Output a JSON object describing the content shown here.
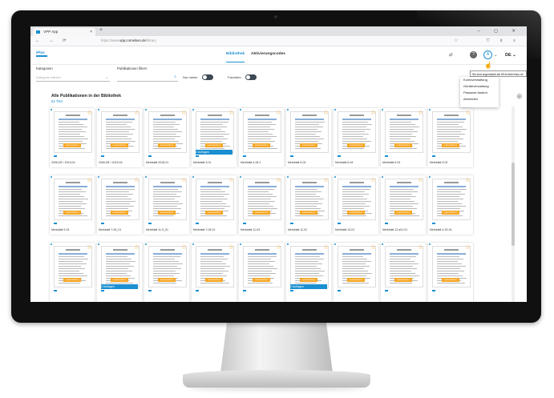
{
  "browser": {
    "tab_title": "VPP App",
    "new_tab": "+",
    "window_controls": "– ◻ ✕",
    "nav_buttons": "← → ⟳",
    "url_prefix": "https://www.",
    "url_domain": "vpp.cornelsen.de",
    "url_path": "/library",
    "star": "☆",
    "right_icons": "⛉ ⇩ ≡"
  },
  "header": {
    "logo_text": "iPlus",
    "tabs": [
      {
        "label": "Bibliothek",
        "active": true
      },
      {
        "label": "Aktivierungscodes",
        "active": false
      }
    ],
    "help_icon": "?",
    "avatar_initial": "A",
    "language": "DE"
  },
  "filters": {
    "category_label": "Kategorien",
    "category_placeholder": "Kategorie wählen",
    "search_label": "Publikationen filtern",
    "toggle_own_label": "Nur meine",
    "toggle_fav_label": "Favoriten"
  },
  "account_menu": {
    "tooltip": "Sie sind angemeldet als DE/schulen/aus.de",
    "items": [
      "Kontoverwaltung",
      "Geräteverwaltung",
      "Passwort ändern",
      "Abmelden"
    ]
  },
  "library": {
    "title": "Alle Publikationen in der Bibliothek",
    "count": "62 Titel"
  },
  "accent_color": "#1a8fd1",
  "highlight_color": "#f5a623",
  "cards": [
    {
      "caption": "2006-DE / 2019-04",
      "badge": "Lesezeichen"
    },
    {
      "caption": "2006-DE / 2019-04",
      "badge": "Lesezeichen"
    },
    {
      "caption": "Merkblatt 2018-01",
      "badge": "Lesezeichen"
    },
    {
      "caption": "Merkblatt 3-01",
      "badge": "Lesezeichen",
      "extra": "2 Auflagen"
    },
    {
      "caption": "Merkblatt 4-06-1",
      "badge": "Lesezeichen"
    },
    {
      "caption": "Merkblatt 5-03",
      "badge": "Lesezeichen"
    },
    {
      "caption": "Merkblatt 6-04",
      "badge": "Lesezeichen"
    },
    {
      "caption": "Merkblatt 6-02",
      "badge": "Lesezeichen"
    },
    {
      "caption": "Merkblatt 9-02",
      "badge": "Lesezeichen"
    },
    {
      "caption": "Merkblatt 9-03",
      "badge": "Lesezeichen"
    },
    {
      "caption": "Merkblatt 7-09_01",
      "badge": "Lesezeichen"
    },
    {
      "caption": "Merkblatt 11-3_01",
      "badge": "Lesezeichen"
    },
    {
      "caption": "Merkblatt 7-09-01",
      "badge": "Lesezeichen"
    },
    {
      "caption": "Merkblatt 11-03",
      "badge": "Lesezeichen"
    },
    {
      "caption": "Merkblatt 11-02",
      "badge": "Lesezeichen"
    },
    {
      "caption": "Merkblatt 13-01",
      "badge": "Lesezeichen"
    },
    {
      "caption": "Merkblatt 12-a01.01",
      "badge": "Lesezeichen"
    },
    {
      "caption": "Merkblatt 4-S2-01",
      "badge": "Lesezeichen"
    },
    {
      "caption": "",
      "badge": "Lesezeichen"
    },
    {
      "caption": "",
      "badge": "Lesezeichen",
      "extra": "2 Auflagen"
    },
    {
      "caption": "",
      "badge": "Lesezeichen"
    },
    {
      "caption": "",
      "badge": "Lesezeichen"
    },
    {
      "caption": "",
      "badge": "Lesezeichen"
    },
    {
      "caption": "",
      "badge": "Lesezeichen",
      "extra": "2 Auflagen"
    },
    {
      "caption": "",
      "badge": "Lesezeichen"
    },
    {
      "caption": "",
      "badge": "Lesezeichen"
    },
    {
      "caption": "",
      "badge": "Lesezeichen"
    }
  ]
}
